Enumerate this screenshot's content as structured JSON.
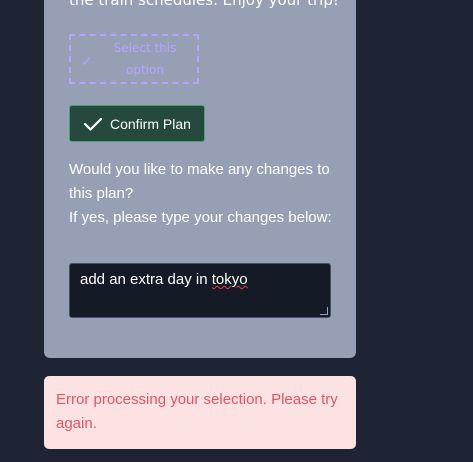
{
  "plan_card": {
    "intro_text": "the train schedules. Enjoy your trip!",
    "option_button_label": "Select this option",
    "confirm_button_label": "Confirm Plan",
    "question_line1": "Would you like to make any changes to this plan?",
    "question_line2": "If yes, please type your changes below:",
    "changes_input": {
      "value_prefix": "add an extra day in ",
      "value_misspelled": "tokyo"
    }
  },
  "error": {
    "message": "Error processing your selection. Please try again."
  },
  "colors": {
    "background": "#1e2433",
    "card": "#979fb5",
    "confirm_button": "#25493c",
    "error_bg": "#fde2e3",
    "error_text": "#e05565",
    "option_border": "#b4a6ff"
  }
}
